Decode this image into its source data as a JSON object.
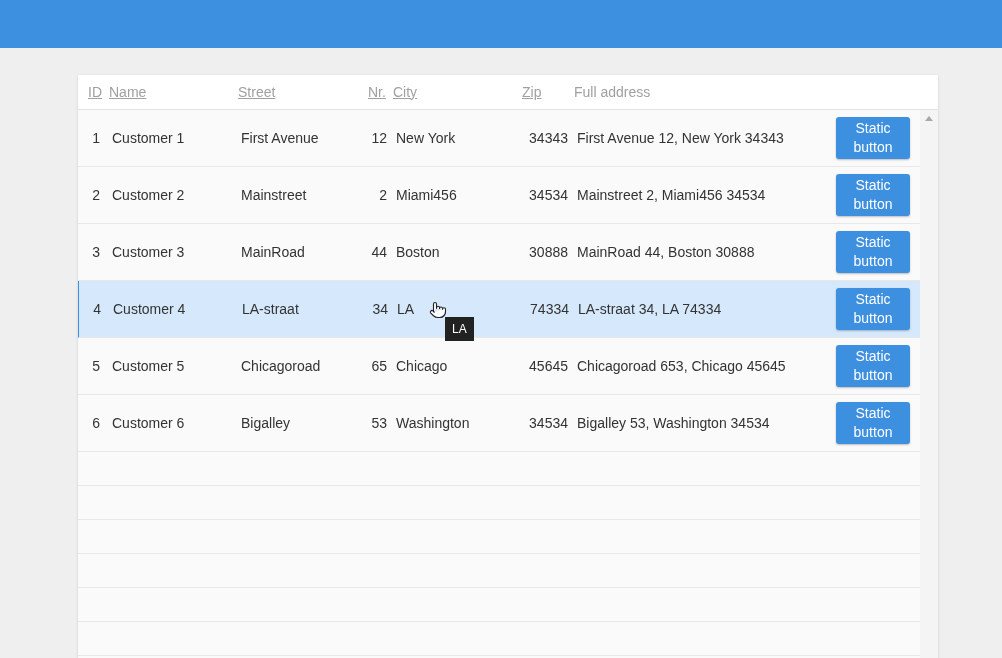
{
  "table": {
    "columns": [
      {
        "label": "ID",
        "sortable": true
      },
      {
        "label": "Name",
        "sortable": true
      },
      {
        "label": "Street",
        "sortable": true
      },
      {
        "label": "Nr.",
        "sortable": true
      },
      {
        "label": "City",
        "sortable": true
      },
      {
        "label": "Zip",
        "sortable": true
      },
      {
        "label": "Full address",
        "sortable": false
      }
    ],
    "rows": [
      {
        "id": "1",
        "name": "Customer 1",
        "street": "First Avenue",
        "nr": "12",
        "city": "New York",
        "zip": "34343",
        "address": "First Avenue 12, New York 34343",
        "button": "Static button",
        "selected": false
      },
      {
        "id": "2",
        "name": "Customer 2",
        "street": "Mainstreet",
        "nr": "2",
        "city": "Miami456",
        "zip": "34534",
        "address": "Mainstreet 2, Miami456 34534",
        "button": "Static button",
        "selected": false
      },
      {
        "id": "3",
        "name": "Customer 3",
        "street": "MainRoad",
        "nr": "44",
        "city": "Boston",
        "zip": "30888",
        "address": "MainRoad 44, Boston 30888",
        "button": "Static button",
        "selected": false
      },
      {
        "id": "4",
        "name": "Customer 4",
        "street": "LA-straat",
        "nr": "34",
        "city": "LA",
        "zip": "74334",
        "address": "LA-straat 34, LA 74334",
        "button": "Static button",
        "selected": true,
        "tooltip": "LA"
      },
      {
        "id": "5",
        "name": "Customer 5",
        "street": "Chicagoroad",
        "nr": "65",
        "city": "Chicago",
        "zip": "45645",
        "address": "Chicagoroad 653, Chicago 45645",
        "button": "Static button",
        "selected": false
      },
      {
        "id": "6",
        "name": "Customer 6",
        "street": "Bigalley",
        "nr": "53",
        "city": "Washington",
        "zip": "34534",
        "address": "Bigalley 53, Washington 34534",
        "button": "Static button",
        "selected": false
      }
    ]
  }
}
